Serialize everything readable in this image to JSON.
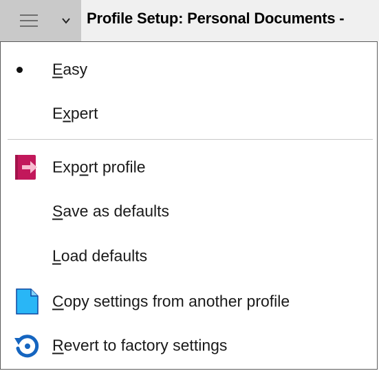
{
  "titlebar": {
    "title": "Profile Setup: Personal Documents -"
  },
  "menu": {
    "items": [
      {
        "label_pre": "",
        "label_u": "E",
        "label_post": "asy",
        "checked": true
      },
      {
        "label_pre": "E",
        "label_u": "x",
        "label_post": "pert",
        "checked": false
      },
      {
        "label_pre": "Exp",
        "label_u": "o",
        "label_post": "rt profile",
        "icon": "export-icon"
      },
      {
        "label_pre": "",
        "label_u": "S",
        "label_post": "ave as defaults"
      },
      {
        "label_pre": "",
        "label_u": "L",
        "label_post": "oad defaults"
      },
      {
        "label_pre": "",
        "label_u": "C",
        "label_post": "opy settings from another profile",
        "icon": "document-icon"
      },
      {
        "label_pre": "",
        "label_u": "R",
        "label_post": "evert to factory settings",
        "icon": "revert-icon"
      }
    ]
  },
  "colors": {
    "menu_button_bg": "#c9c9c9",
    "titlebar_bg": "#f0f0f0",
    "export_icon": "#c2185b",
    "document_icon": "#29b6f6",
    "revert_icon": "#1565c0"
  }
}
